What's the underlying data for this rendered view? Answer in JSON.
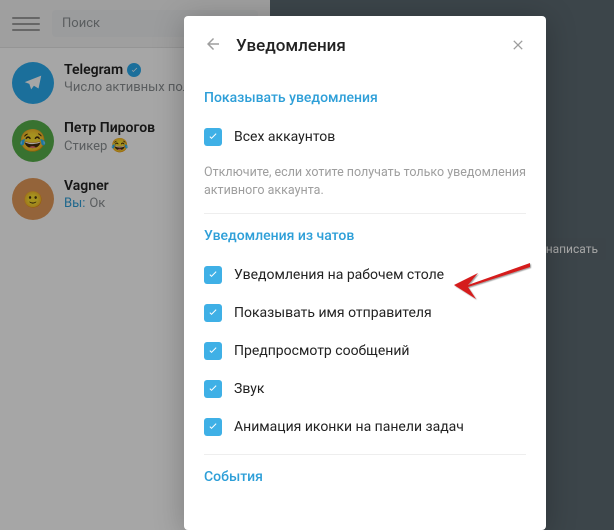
{
  "search": {
    "placeholder": "Поиск"
  },
  "chats": {
    "telegram": {
      "name": "Telegram",
      "sub": "Число активных поль"
    },
    "petr": {
      "name": "Петр Пирогов",
      "sub_prefix": "Стикер"
    },
    "vagner": {
      "name": "Vagner",
      "you_prefix": "Вы:",
      "msg": "Ок"
    }
  },
  "write_button": "написать",
  "modal": {
    "title": "Уведомления",
    "section1_title": "Показывать уведомления",
    "all_accounts": "Всех аккаунтов",
    "hint": "Отключите, если хотите получать только уведомления активного аккаунта.",
    "section2_title": "Уведомления из чатов",
    "desktop_notifications": "Уведомления на рабочем столе",
    "show_sender": "Показывать имя отправителя",
    "preview": "Предпросмотр сообщений",
    "sound": "Звук",
    "taskbar_anim": "Анимация иконки на панели задач",
    "section3_title": "События"
  }
}
